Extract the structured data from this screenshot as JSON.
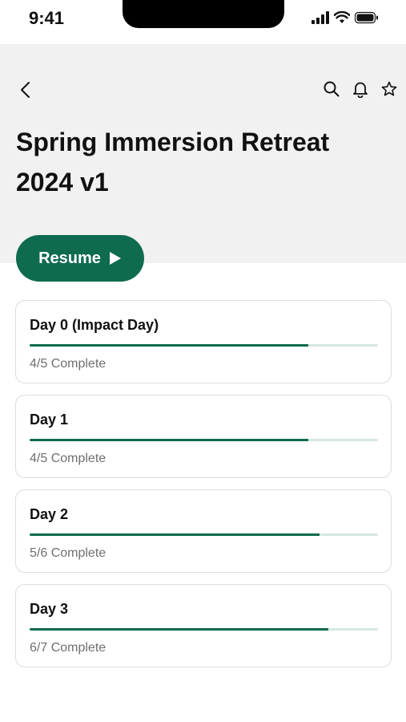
{
  "status_bar": {
    "time": "9:41",
    "icons": [
      "signal-icon",
      "wifi-icon",
      "battery-icon"
    ]
  },
  "header": {
    "back_icon": "chevron-left-icon",
    "action_icons": [
      "search-icon",
      "bell-icon",
      "star-icon"
    ],
    "title": "Spring Immersion Retreat 2024 v1"
  },
  "resume_button": {
    "label": "Resume",
    "icon": "play-icon"
  },
  "colors": {
    "accent": "#0f6b4f",
    "header_background": "#f1f1f1",
    "muted_text": "#6f6f6f"
  },
  "days": [
    {
      "title": "Day 0 (Impact Day)",
      "status": "4/5 Complete",
      "progress": 0.8
    },
    {
      "title": "Day 1",
      "status": "4/5 Complete",
      "progress": 0.8
    },
    {
      "title": "Day 2",
      "status": "5/6 Complete",
      "progress": 0.833
    },
    {
      "title": "Day 3",
      "status": "6/7 Complete",
      "progress": 0.857
    }
  ]
}
